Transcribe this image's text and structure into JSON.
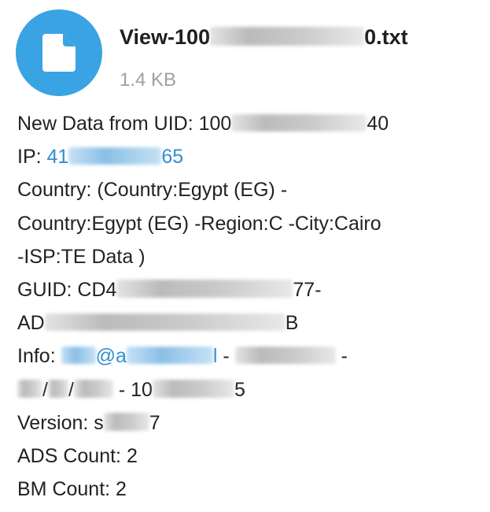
{
  "file": {
    "name_prefix": "View-100",
    "name_suffix": "0.txt",
    "size": "1.4 KB",
    "icon": "document-icon",
    "icon_color": "#3aa3e3"
  },
  "message": {
    "line1_label": "New Data from UID: 100",
    "line1_tail": "40",
    "ip_label": "IP: ",
    "ip_start": "41",
    "ip_end": "65",
    "country_line1": "Country: (Country:Egypt (EG) -",
    "country_line2": "Country:Egypt (EG) -Region:C -City:Cairo",
    "country_line3": "-ISP:TE Data )",
    "guid_label": "GUID: CD4",
    "guid_tail": "77-",
    "ad_start": "AD",
    "ad_tail": "B",
    "info_label": "Info: ",
    "info_email_part": "@a",
    "info_l": "l",
    "info_dash": " - ",
    "info_dash2": " -",
    "date_sep1": "/",
    "date_sep2": "/",
    "date_mid": " - 10",
    "date_tail": "5",
    "version_label": "Version: s",
    "version_tail": "7",
    "ads_count": "ADS Count: 2",
    "bm_count": "BM Count: 2"
  },
  "colors": {
    "link": "#2f8fcf",
    "secondary_text": "#9aa1a8"
  }
}
